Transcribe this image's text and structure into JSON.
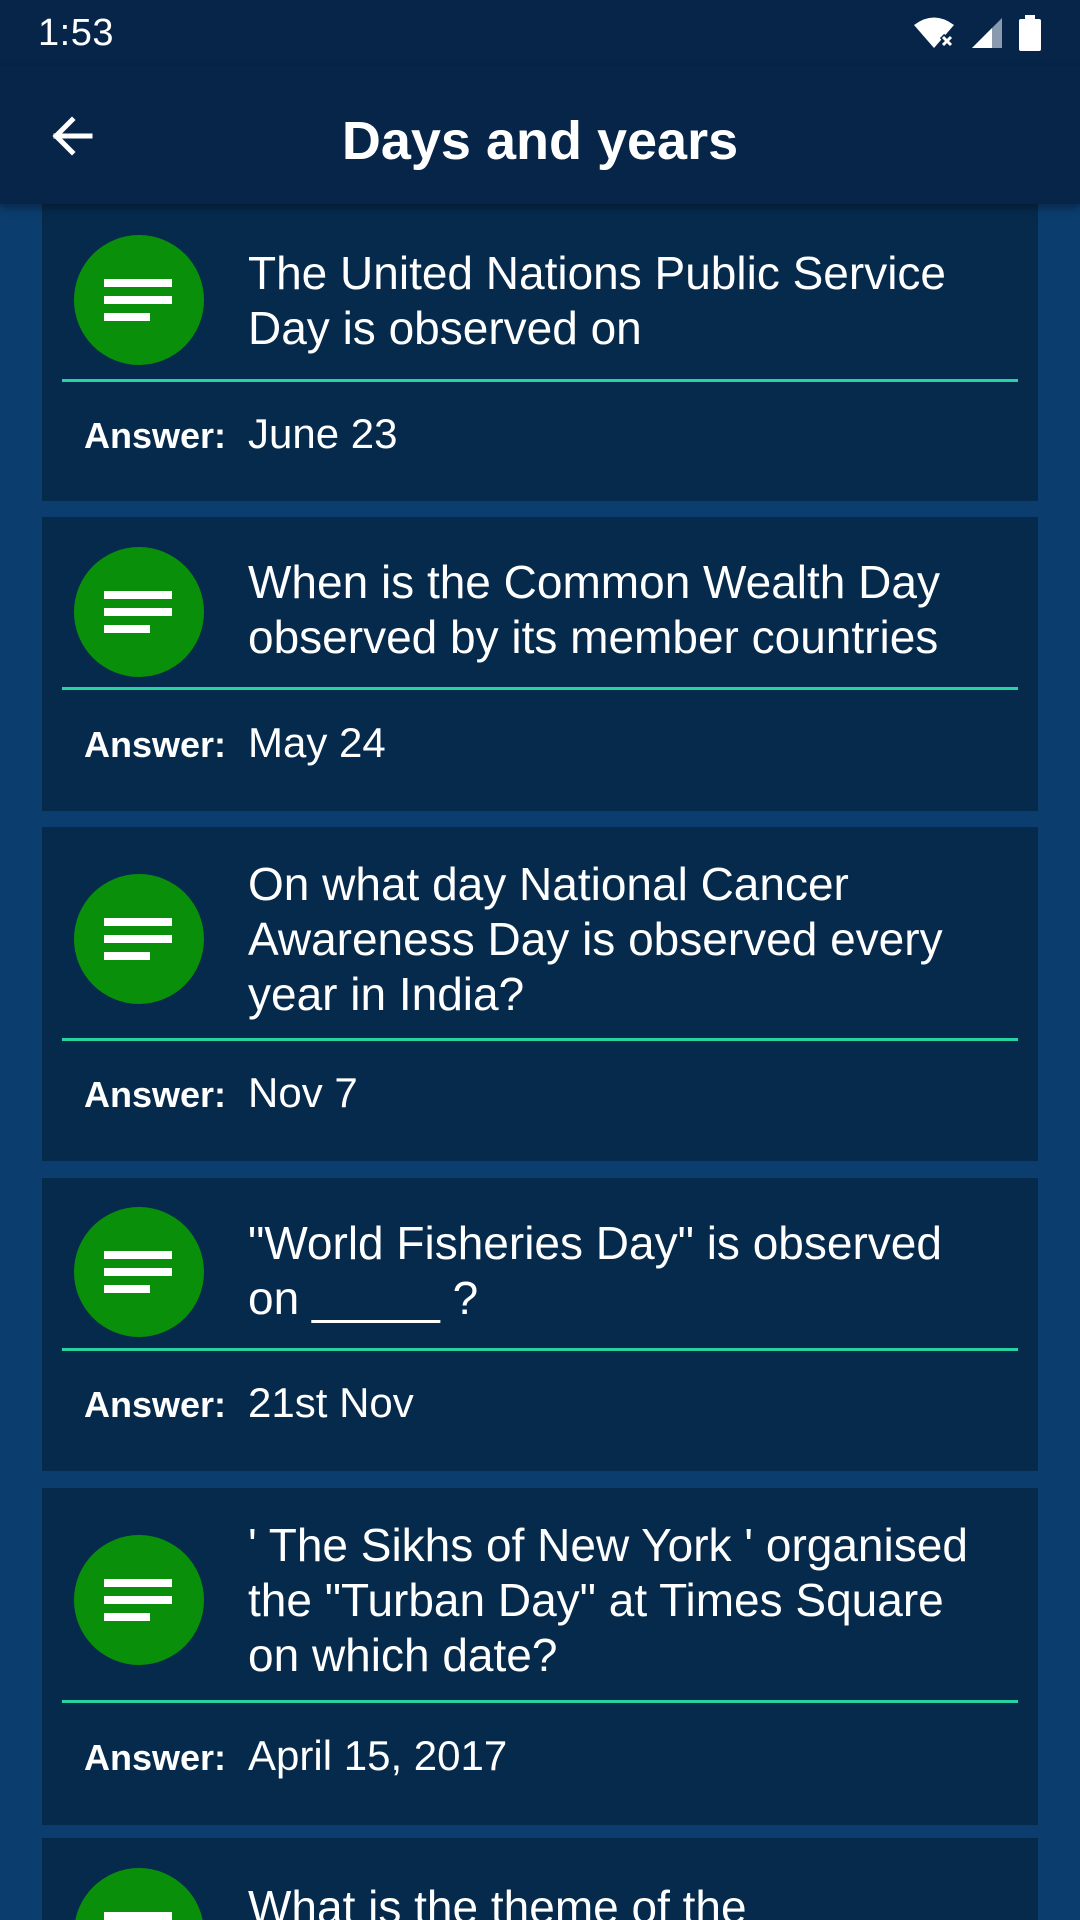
{
  "status_bar": {
    "time": "1:53"
  },
  "app_bar": {
    "title": "Days and years"
  },
  "answer_label": "Answer:",
  "cards": [
    {
      "question": "The United Nations Public Service Day is observed on",
      "answer": "June 23"
    },
    {
      "question": "When is the Common Wealth Day observed by its member countries",
      "answer": "May 24"
    },
    {
      "question": "On what day National Cancer Awareness Day is observed every year in India?",
      "answer": "Nov 7"
    },
    {
      "question": "\"World Fisheries Day\" is observed on _____ ?",
      "answer": "21st Nov"
    },
    {
      "question": "' The Sikhs of New York ' organised the \"Turban Day\" at Times Square on which date?",
      "answer": "April 15, 2017"
    },
    {
      "question": "What is the theme of the",
      "answer": ""
    }
  ],
  "colors": {
    "background": "#0b3d6e",
    "app_bar": "#062548",
    "card": "#062a4c",
    "avatar": "#0a8f0a",
    "divider": "#27d3a0"
  },
  "icons": {
    "back": "arrow-back-icon",
    "card": "notes-icon",
    "wifi": "wifi-icon",
    "signal": "signal-icon",
    "battery": "battery-icon"
  }
}
